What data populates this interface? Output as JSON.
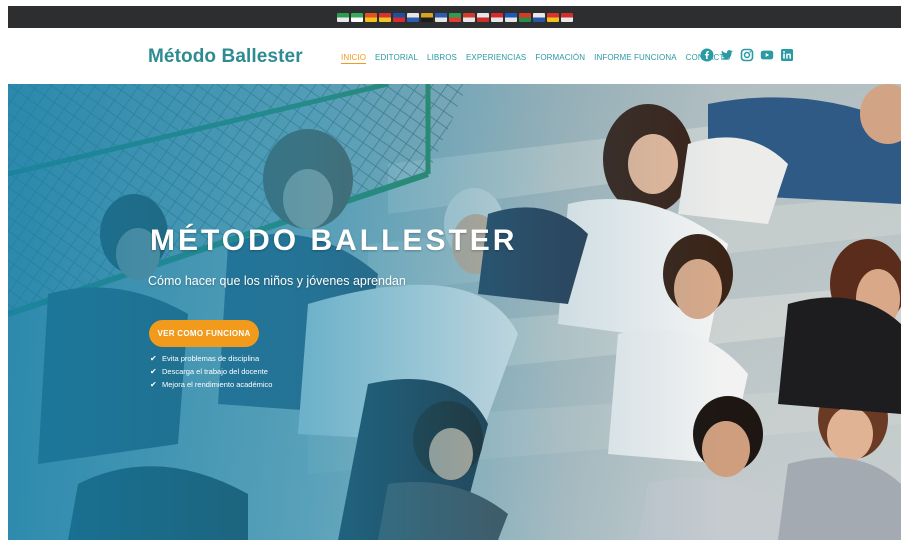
{
  "brand": {
    "name": "Método Ballester",
    "color": "#2e8b92"
  },
  "top_bar": {
    "flags": [
      {
        "icon": "flag-icon",
        "colors": [
          "#2e9c4f",
          "#e8e8e8"
        ]
      },
      {
        "icon": "flag-icon",
        "colors": [
          "#39a85a",
          "#ffffff"
        ]
      },
      {
        "icon": "flag-icon",
        "colors": [
          "#e25322",
          "#f4c21b"
        ]
      },
      {
        "icon": "flag-icon",
        "colors": [
          "#d8322e",
          "#f0c521"
        ]
      },
      {
        "icon": "flag-icon",
        "colors": [
          "#1e4fa0",
          "#d92b2b"
        ]
      },
      {
        "icon": "flag-icon",
        "colors": [
          "#e6e6e6",
          "#2b5db0"
        ]
      },
      {
        "icon": "flag-icon",
        "colors": [
          "#d6a51f",
          "#1c1c1c"
        ]
      },
      {
        "icon": "flag-icon",
        "colors": [
          "#2f5bb0",
          "#e6e6e6"
        ]
      },
      {
        "icon": "flag-icon",
        "colors": [
          "#2d9d55",
          "#e33b2e"
        ]
      },
      {
        "icon": "flag-icon",
        "colors": [
          "#d63a2c",
          "#e6e6e6"
        ]
      },
      {
        "icon": "flag-icon",
        "colors": [
          "#e6e6e6",
          "#d22b2b"
        ]
      },
      {
        "icon": "flag-icon",
        "colors": [
          "#d92a2a",
          "#e6e6e6"
        ]
      },
      {
        "icon": "flag-icon",
        "colors": [
          "#1f59b7",
          "#e6e6e6"
        ]
      },
      {
        "icon": "flag-icon",
        "colors": [
          "#d63b23",
          "#2c8a4a"
        ]
      },
      {
        "icon": "flag-icon",
        "colors": [
          "#e9e9e9",
          "#2b55a8"
        ]
      },
      {
        "icon": "flag-icon",
        "colors": [
          "#d9342b",
          "#f2c31e"
        ]
      },
      {
        "icon": "flag-icon",
        "colors": [
          "#d12e2e",
          "#e9e9e9"
        ]
      }
    ]
  },
  "nav": {
    "items": [
      {
        "label": "INICIO",
        "active": true
      },
      {
        "label": "EDITORIAL",
        "active": false
      },
      {
        "label": "LIBROS",
        "active": false
      },
      {
        "label": "EXPERIENCIAS",
        "active": false
      },
      {
        "label": "FORMACIÓN",
        "active": false
      },
      {
        "label": "INFORME FUNCIONA",
        "active": false
      },
      {
        "label": "CONTACTO",
        "active": false
      }
    ],
    "active_color": "#f29a1c",
    "link_color": "#2a9aa3"
  },
  "socials": [
    {
      "icon": "facebook-icon",
      "glyph": "f"
    },
    {
      "icon": "twitter-icon",
      "glyph": "t"
    },
    {
      "icon": "instagram-icon",
      "glyph": "i"
    },
    {
      "icon": "youtube-icon",
      "glyph": "▶"
    },
    {
      "icon": "linkedin-icon",
      "glyph": "in"
    }
  ],
  "hero": {
    "title": "MÉTODO BALLESTER",
    "subtitle": "Cómo hacer que los niños y jóvenes aprendan",
    "cta_label": "VER COMO FUNCIONA",
    "cta_color": "#f29a1c",
    "bullets": [
      "Evita problemas de disciplina",
      "Descarga el trabajo del docente",
      "Mejora el rendimiento académico"
    ],
    "check_icon": "check-icon"
  }
}
